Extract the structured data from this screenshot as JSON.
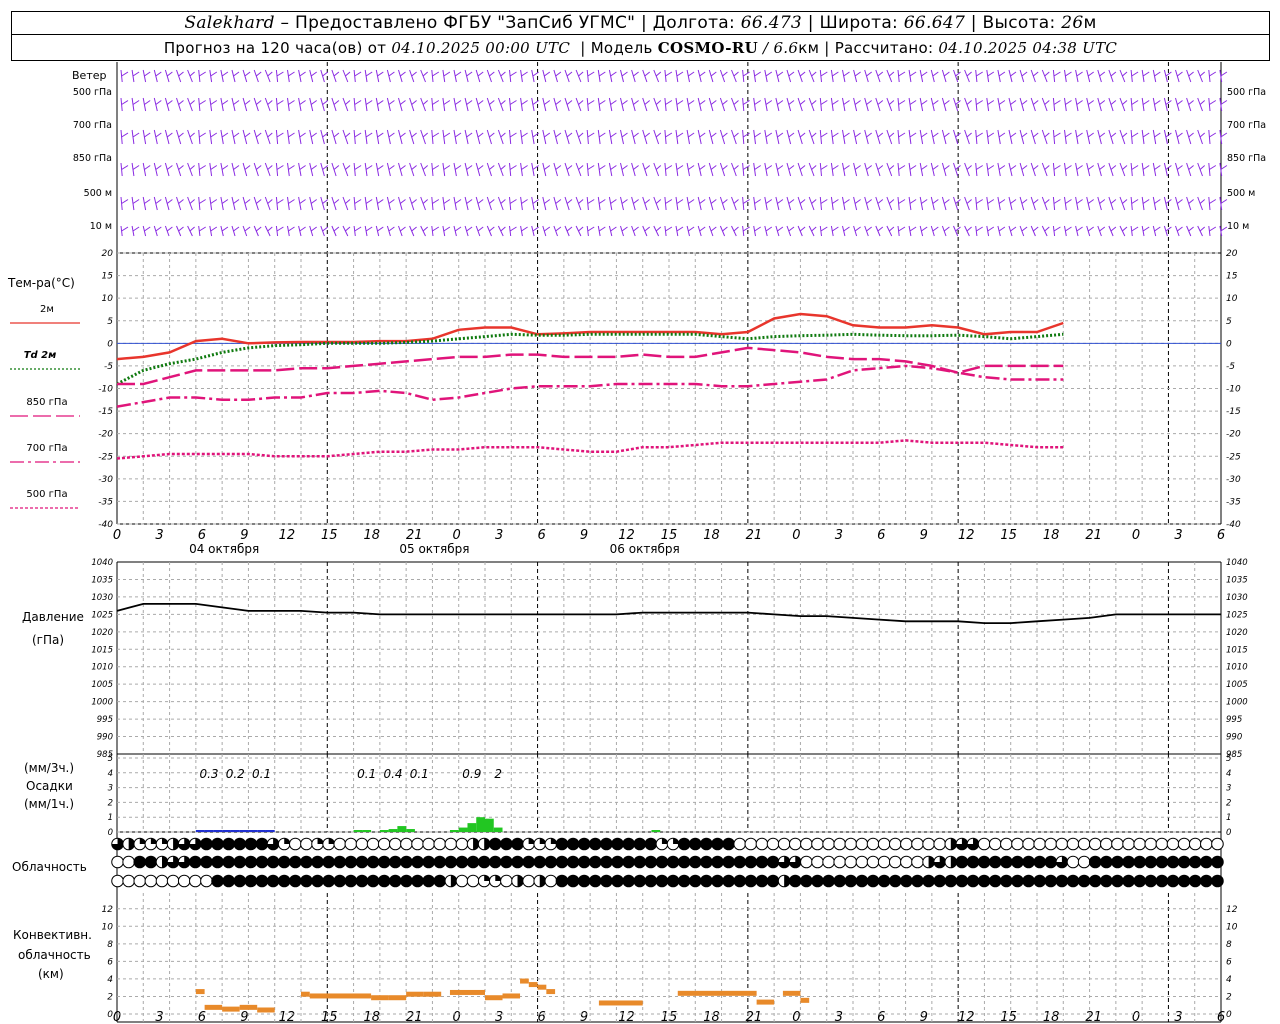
{
  "header": {
    "station": "Salekhard",
    "provider": "– Предоставлено ФГБУ \"ЗапСиб УГМС\"",
    "lon_label": "Долгота:",
    "lon_value": "66.473",
    "lat_label": "Широта:",
    "lat_value": "66.647",
    "alt_label": "Высота:",
    "alt_value": "26",
    "alt_unit": "м",
    "forecast_prefix": "Прогноз на 120 часа(ов) от",
    "forecast_date": "04.10.2025 00:00 UTC",
    "model_label": "Модель",
    "model_name": "COSMO-RU",
    "model_res": "/ 6.6",
    "model_res_unit": "км",
    "calc_label": "Рассчитано:",
    "calc_date": "04.10.2025 04:38 UTC"
  },
  "colors": {
    "t2m": "#e8352c",
    "td2m": "#0f7a0f",
    "t850": "#e0147a",
    "t700": "#e0147a",
    "t500": "#e0147a",
    "wind": "#8a2be2",
    "precip_blue": "#1f2fd0",
    "precip_green": "#22c622",
    "conv": "#e88a2a",
    "zero_line": "#2f4fd0"
  },
  "wind_panel": {
    "title": "Ветер",
    "levels": [
      "500 гПа",
      "700 гПа",
      "850 гПа",
      "500 м",
      "10 м"
    ]
  },
  "time_axis": {
    "hour_ticks": [
      "0",
      "3",
      "6",
      "9",
      "12",
      "15",
      "18",
      "21",
      "0",
      "3",
      "6",
      "9",
      "12",
      "15",
      "18",
      "21",
      "0",
      "3",
      "6",
      "9",
      "12",
      "15",
      "18",
      "21",
      "0",
      "3",
      "6"
    ],
    "day_labels": [
      "04 октября",
      "05 октября",
      "06 октября"
    ]
  },
  "chart_data": [
    {
      "type": "line",
      "name": "temperature",
      "ylabel": "Тем-ра(°С)",
      "ylim": [
        -40,
        20
      ],
      "yticks": [
        "20",
        "15",
        "10",
        "5",
        "0",
        "-5",
        "-10",
        "-15",
        "-20",
        "-25",
        "-30",
        "-35",
        "-40"
      ],
      "x_hours": [
        0,
        3,
        6,
        9,
        12,
        15,
        18,
        21,
        24,
        27,
        30,
        33,
        36,
        39,
        42,
        45,
        48,
        51,
        54,
        57,
        60,
        63,
        66,
        69,
        72,
        75,
        78,
        81,
        84,
        87,
        90,
        93,
        96,
        99,
        102,
        105,
        108,
        111,
        114,
        117,
        120,
        123,
        126
      ],
      "series": [
        {
          "name": "2м",
          "style": "solid",
          "values": [
            -3.5,
            -3,
            -2,
            0.5,
            1,
            0,
            0.2,
            0.3,
            0.3,
            0.3,
            0.5,
            0.5,
            1,
            3,
            3.5,
            3.5,
            2,
            2.2,
            2.5,
            2.5,
            2.5,
            2.5,
            2.5,
            2,
            2.5,
            5.5,
            6.5,
            6,
            4,
            3.5,
            3.5,
            4,
            3.5,
            2,
            2.5,
            2.5,
            4.5
          ]
        },
        {
          "name": "Td 2м",
          "style": "dotted",
          "values": [
            -9,
            -6,
            -4.5,
            -3.5,
            -2,
            -1,
            -0.5,
            -0.3,
            0,
            0,
            0,
            0.2,
            0.5,
            1,
            1.5,
            2,
            1.8,
            1.8,
            2,
            2,
            2,
            2,
            2,
            1.5,
            1,
            1.5,
            1.7,
            1.8,
            2,
            1.8,
            1.7,
            1.7,
            1.8,
            1.5,
            1,
            1.5,
            2
          ]
        },
        {
          "name": "850 гПа",
          "style": "dashed",
          "values": [
            -9,
            -9,
            -7.5,
            -6,
            -6,
            -6,
            -6,
            -5.5,
            -5.5,
            -5,
            -4.5,
            -4,
            -3.5,
            -3,
            -3,
            -2.5,
            -2.5,
            -3,
            -3,
            -3,
            -2.5,
            -3,
            -3,
            -2,
            -1,
            -1.5,
            -2,
            -3,
            -3.5,
            -3.5,
            -4,
            -5,
            -6.5,
            -5,
            -5,
            -5,
            -5
          ]
        },
        {
          "name": "700 гПа",
          "style": "dashdot",
          "values": [
            -14,
            -13,
            -12,
            -12,
            -12.5,
            -12.5,
            -12,
            -12,
            -11,
            -11,
            -10.5,
            -11,
            -12.5,
            -12,
            -11,
            -10,
            -9.5,
            -9.5,
            -9.5,
            -9,
            -9,
            -9,
            -9,
            -9.5,
            -9.5,
            -9,
            -8.5,
            -8,
            -6,
            -5.5,
            -5,
            -5.5,
            -6.5,
            -7.5,
            -8,
            -8,
            -8
          ]
        },
        {
          "name": "500 гПа",
          "style": "fine-dashed",
          "values": [
            -25.5,
            -25,
            -24.5,
            -24.5,
            -24.5,
            -24.5,
            -25,
            -25,
            -25,
            -24.5,
            -24,
            -24,
            -23.5,
            -23.5,
            -23,
            -23,
            -23,
            -23.5,
            -24,
            -24,
            -23,
            -23,
            -22.5,
            -22,
            -22,
            -22,
            -22,
            -22,
            -22,
            -22,
            -21.5,
            -22,
            -22,
            -22,
            -22.5,
            -23,
            -23
          ]
        }
      ]
    },
    {
      "type": "line",
      "name": "pressure",
      "ylabel": "Давление",
      "yunit": "(гПа)",
      "ylim": [
        985,
        1040
      ],
      "yticks": [
        "1040",
        "1035",
        "1030",
        "1025",
        "1020",
        "1015",
        "1010",
        "1005",
        "1000",
        "995",
        "990",
        "985"
      ],
      "x_hours": [
        0,
        3,
        6,
        9,
        12,
        15,
        18,
        21,
        24,
        27,
        30,
        33,
        36,
        39,
        42,
        45,
        48,
        51,
        54,
        57,
        60,
        63,
        66,
        69,
        72,
        75,
        78,
        81,
        84,
        87,
        90,
        93,
        96,
        99,
        102,
        105,
        108,
        111,
        114,
        117,
        120,
        123,
        126
      ],
      "series": [
        {
          "name": "pressure",
          "values": [
            1026,
            1028,
            1028,
            1028,
            1027,
            1026,
            1026,
            1026,
            1025.5,
            1025.5,
            1025,
            1025,
            1025,
            1025,
            1025,
            1025,
            1025,
            1025,
            1025,
            1025,
            1025.5,
            1025.5,
            1025.5,
            1025.5,
            1025.5,
            1025,
            1024.5,
            1024.5,
            1024,
            1023.5,
            1023,
            1023,
            1023,
            1022.5,
            1022.5,
            1023,
            1023.5,
            1024,
            1025,
            1025,
            1025,
            1025,
            1025
          ]
        }
      ]
    },
    {
      "type": "bar",
      "name": "precipitation",
      "ylabel": "Осадки",
      "yunit_3h": "(мм/3ч.)",
      "yunit_1h": "(мм/1ч.)",
      "ylim": [
        0,
        5
      ],
      "yticks": [
        "5",
        "4",
        "3",
        "2",
        "1",
        "0"
      ],
      "labels": [
        {
          "hour": 10.5,
          "text": "0.3"
        },
        {
          "hour": 13.5,
          "text": "0.2"
        },
        {
          "hour": 16.5,
          "text": "0.1"
        },
        {
          "hour": 28.5,
          "text": "0.1"
        },
        {
          "hour": 31.5,
          "text": "0.4"
        },
        {
          "hour": 34.5,
          "text": "0.1"
        },
        {
          "hour": 40.5,
          "text": "0.9"
        },
        {
          "hour": 43.5,
          "text": "2"
        }
      ],
      "bars": [
        {
          "hour": 9,
          "value": 0.1,
          "color": "blue"
        },
        {
          "hour": 10,
          "value": 0.1,
          "color": "blue"
        },
        {
          "hour": 11,
          "value": 0.1,
          "color": "blue"
        },
        {
          "hour": 12,
          "value": 0.1,
          "color": "blue"
        },
        {
          "hour": 13,
          "value": 0.1,
          "color": "blue"
        },
        {
          "hour": 14,
          "value": 0.1,
          "color": "blue"
        },
        {
          "hour": 15,
          "value": 0.05,
          "color": "blue"
        },
        {
          "hour": 16,
          "value": 0.05,
          "color": "blue"
        },
        {
          "hour": 17,
          "value": 0.05,
          "color": "blue"
        },
        {
          "hour": 27,
          "value": 0.05,
          "color": "green"
        },
        {
          "hour": 28,
          "value": 0.05,
          "color": "green"
        },
        {
          "hour": 30,
          "value": 0.1,
          "color": "green"
        },
        {
          "hour": 31,
          "value": 0.2,
          "color": "green"
        },
        {
          "hour": 32,
          "value": 0.4,
          "color": "green"
        },
        {
          "hour": 33,
          "value": 0.2,
          "color": "green"
        },
        {
          "hour": 38,
          "value": 0.1,
          "color": "green"
        },
        {
          "hour": 39,
          "value": 0.3,
          "color": "green"
        },
        {
          "hour": 40,
          "value": 0.6,
          "color": "green"
        },
        {
          "hour": 41,
          "value": 1.0,
          "color": "green"
        },
        {
          "hour": 42,
          "value": 0.9,
          "color": "green"
        },
        {
          "hour": 43,
          "value": 0.3,
          "color": "green"
        },
        {
          "hour": 61,
          "value": 0.05,
          "color": "green"
        }
      ]
    },
    {
      "type": "table",
      "name": "cloudiness",
      "ylabel": "Облачность",
      "rows": [
        {
          "name": "high",
          "values": [
            3,
            2,
            1,
            1,
            1,
            2,
            3,
            3,
            4,
            4,
            4,
            4,
            4,
            4,
            3,
            1,
            0,
            0,
            1,
            1,
            0,
            0,
            0,
            0,
            0,
            0,
            0,
            0,
            0,
            0,
            0,
            0,
            2,
            2,
            4,
            4,
            4,
            1,
            1,
            1,
            4,
            4,
            4,
            4,
            4,
            4,
            4,
            4,
            4,
            1,
            1,
            4,
            4,
            4,
            4,
            4,
            0,
            0,
            0,
            0,
            0,
            0,
            0,
            0,
            0,
            0,
            0,
            0,
            0,
            0,
            0,
            0,
            0,
            0,
            0,
            2,
            3,
            3,
            0,
            0,
            0,
            0,
            0,
            0,
            0,
            0,
            0,
            0,
            0,
            0,
            0,
            0,
            0,
            0,
            0,
            0,
            0,
            0,
            0,
            0
          ]
        },
        {
          "name": "mid",
          "values": [
            0,
            0,
            4,
            4,
            2,
            3,
            3,
            4,
            4,
            4,
            4,
            4,
            4,
            4,
            4,
            4,
            4,
            4,
            4,
            4,
            4,
            4,
            4,
            4,
            4,
            4,
            4,
            4,
            4,
            4,
            4,
            4,
            4,
            4,
            4,
            4,
            4,
            4,
            4,
            4,
            4,
            4,
            4,
            4,
            4,
            4,
            4,
            4,
            4,
            4,
            4,
            4,
            4,
            4,
            4,
            4,
            4,
            4,
            4,
            4,
            3,
            3,
            0,
            0,
            0,
            0,
            0,
            0,
            0,
            0,
            0,
            0,
            0,
            2,
            3,
            2,
            4,
            4,
            4,
            4,
            4,
            4,
            4,
            4,
            4,
            3,
            0,
            0,
            4,
            4,
            4,
            4,
            4,
            4,
            4,
            4,
            4,
            4,
            4,
            4
          ]
        },
        {
          "name": "low",
          "values": [
            0,
            0,
            0,
            0,
            0,
            0,
            0,
            0,
            0,
            4,
            4,
            4,
            4,
            4,
            4,
            4,
            4,
            4,
            4,
            4,
            4,
            4,
            4,
            4,
            4,
            4,
            4,
            4,
            4,
            4,
            2,
            0,
            0,
            1,
            1,
            0,
            2,
            0,
            2,
            0,
            4,
            4,
            4,
            4,
            4,
            4,
            4,
            4,
            4,
            4,
            4,
            4,
            4,
            4,
            4,
            4,
            4,
            4,
            4,
            4,
            2,
            4,
            4,
            4,
            4,
            4,
            4,
            4,
            4,
            4,
            4,
            4,
            4,
            4,
            4,
            4,
            4,
            4,
            4,
            4,
            4,
            4,
            4,
            4,
            4,
            4,
            4,
            4,
            4,
            4,
            4,
            4,
            4,
            4,
            4,
            4,
            4,
            4,
            4,
            4
          ]
        }
      ]
    },
    {
      "type": "bar",
      "name": "convective_cloudiness",
      "ylabel": "Конвективн.",
      "ylabel2": "облачность",
      "yunit": "(км)",
      "ylim": [
        0,
        13
      ],
      "yticks": [
        "12",
        "10",
        "8",
        "6",
        "4",
        "2",
        "0"
      ],
      "segments": [
        {
          "from": 9,
          "to": 10,
          "value": 2.5
        },
        {
          "from": 10,
          "to": 12,
          "value": 0.7
        },
        {
          "from": 12,
          "to": 14,
          "value": 0.5
        },
        {
          "from": 14,
          "to": 16,
          "value": 0.7
        },
        {
          "from": 16,
          "to": 18,
          "value": 0.4
        },
        {
          "from": 21,
          "to": 22,
          "value": 2.2
        },
        {
          "from": 22,
          "to": 29,
          "value": 2.0
        },
        {
          "from": 29,
          "to": 31,
          "value": 1.8
        },
        {
          "from": 31,
          "to": 33,
          "value": 1.8
        },
        {
          "from": 33,
          "to": 35,
          "value": 2.2
        },
        {
          "from": 35,
          "to": 37,
          "value": 2.2
        },
        {
          "from": 38,
          "to": 42,
          "value": 2.4
        },
        {
          "from": 42,
          "to": 44,
          "value": 1.8
        },
        {
          "from": 44,
          "to": 46,
          "value": 2.0
        },
        {
          "from": 46,
          "to": 47,
          "value": 3.7
        },
        {
          "from": 47,
          "to": 48,
          "value": 3.3
        },
        {
          "from": 48,
          "to": 49,
          "value": 3.0
        },
        {
          "from": 49,
          "to": 50,
          "value": 2.5
        },
        {
          "from": 55,
          "to": 60,
          "value": 1.2
        },
        {
          "from": 64,
          "to": 73,
          "value": 2.3
        },
        {
          "from": 73,
          "to": 75,
          "value": 1.3
        },
        {
          "from": 76,
          "to": 78,
          "value": 2.3
        },
        {
          "from": 78,
          "to": 79,
          "value": 1.5
        }
      ]
    }
  ]
}
